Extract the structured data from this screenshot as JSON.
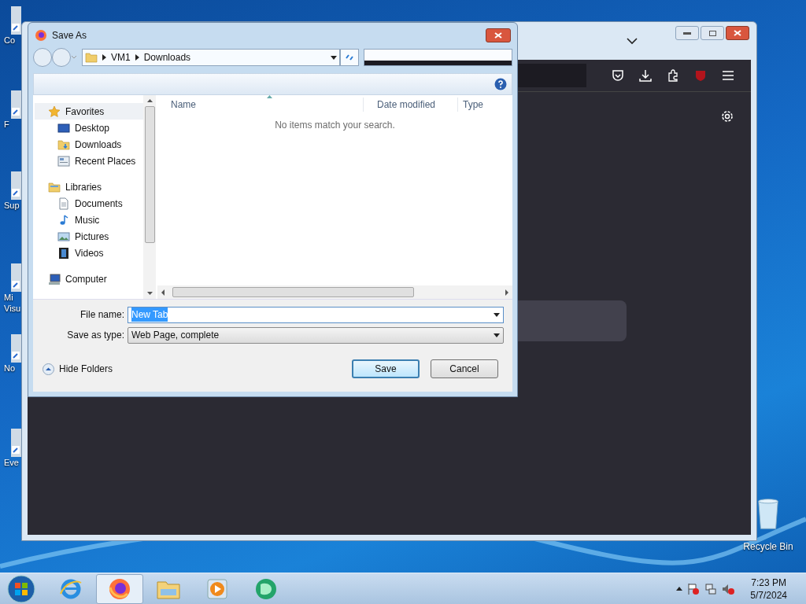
{
  "desktop_icons": [
    {
      "label": "Co"
    },
    {
      "label": "F"
    },
    {
      "label": "Sup"
    },
    {
      "label": "Mi Visu"
    },
    {
      "label": "No"
    },
    {
      "label": "Eve"
    }
  ],
  "recycle_bin": {
    "label": "Recycle Bin"
  },
  "dialog": {
    "title": "Save As",
    "breadcrumb": [
      "VM1",
      "Downloads"
    ],
    "nav_tree": [
      {
        "label": "Favorites",
        "kind": "star",
        "selected": true,
        "children": [
          {
            "label": "Desktop",
            "kind": "desktop",
            "selected": false
          },
          {
            "label": "Downloads",
            "kind": "downloads",
            "selected": false
          },
          {
            "label": "Recent Places",
            "kind": "recent",
            "selected": false
          }
        ]
      },
      {
        "label": "Libraries",
        "kind": "library",
        "selected": false,
        "children": [
          {
            "label": "Documents",
            "kind": "document",
            "selected": false
          },
          {
            "label": "Music",
            "kind": "music",
            "selected": false
          },
          {
            "label": "Pictures",
            "kind": "pictures",
            "selected": false
          },
          {
            "label": "Videos",
            "kind": "videos",
            "selected": false
          }
        ]
      },
      {
        "label": "Computer",
        "kind": "computer",
        "selected": false
      }
    ],
    "columns": [
      "Name",
      "Date modified",
      "Type"
    ],
    "empty_message": "No items match your search.",
    "file_name": {
      "label": "File name:",
      "value": "New Tab"
    },
    "save_type": {
      "label": "Save as type:",
      "value": "Web Page, complete"
    },
    "hide_folders": "Hide Folders",
    "buttons": [
      {
        "label": "Save",
        "default": true
      },
      {
        "label": "Cancel",
        "default": false
      }
    ]
  },
  "taskbar": {
    "apps": [
      {
        "kind": "ie",
        "selected": false
      },
      {
        "kind": "firefox",
        "selected": true
      },
      {
        "kind": "explorer",
        "selected": false
      },
      {
        "kind": "media",
        "selected": false
      },
      {
        "kind": "green",
        "selected": false
      }
    ],
    "clock": {
      "time": "7:23 PM",
      "date": "5/7/2024"
    }
  }
}
